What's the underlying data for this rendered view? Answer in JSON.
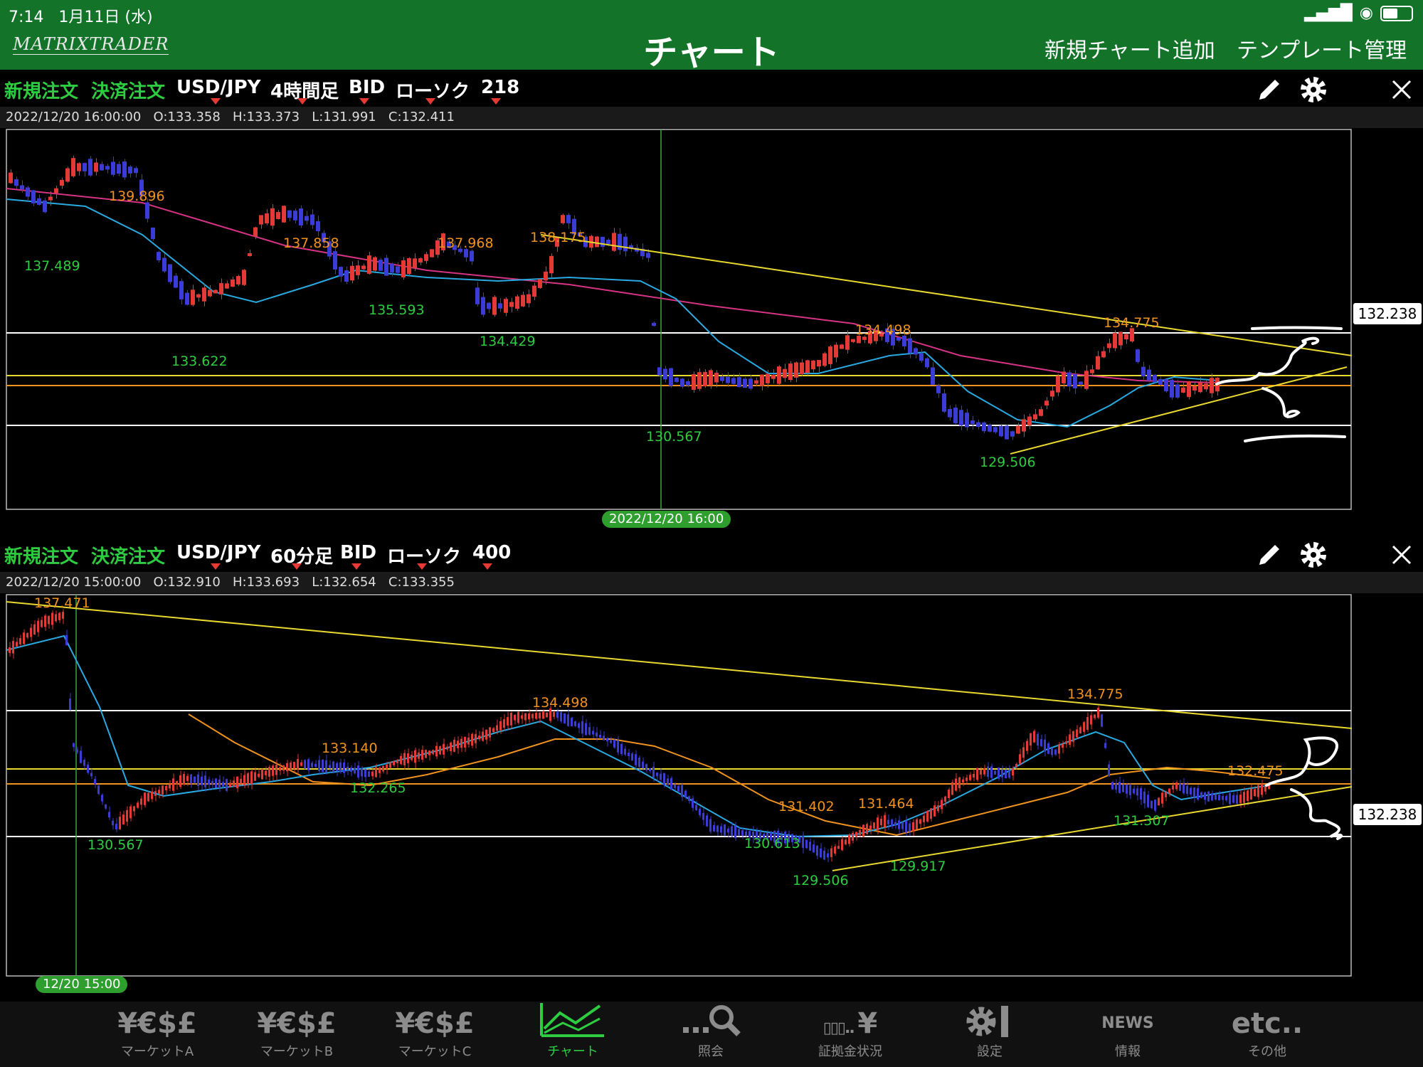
{
  "status": {
    "time": "7:14",
    "date": "1月11日 (水)"
  },
  "header": {
    "logo": "MATRIXTRADER",
    "title": "チャート",
    "add_chart": "新規チャート追加",
    "template": "テンプレート管理"
  },
  "panels": [
    {
      "new_order": "新規注文",
      "close_order": "決済注文",
      "pair": "USD/JPY",
      "timeframe": "4時間足",
      "price_type": "BID",
      "chart_style": "ローソク",
      "count": "218",
      "ohlc": "2022/12/20 16:00:00   O:133.358   H:133.373   L:131.991   C:132.411",
      "current_price": "132.238",
      "crosshair_date": "2022/12/20 16:00",
      "labels": [
        {
          "text": "139.896",
          "kind": "high"
        },
        {
          "text": "137.489",
          "kind": "low"
        },
        {
          "text": "137.858",
          "kind": "high"
        },
        {
          "text": "135.593",
          "kind": "low"
        },
        {
          "text": "133.622",
          "kind": "low"
        },
        {
          "text": "137.968",
          "kind": "high"
        },
        {
          "text": "134.429",
          "kind": "low"
        },
        {
          "text": "138.175",
          "kind": "high"
        },
        {
          "text": "130.567",
          "kind": "low"
        },
        {
          "text": "134.498",
          "kind": "high"
        },
        {
          "text": "129.506",
          "kind": "low"
        },
        {
          "text": "134.775",
          "kind": "high"
        }
      ]
    },
    {
      "new_order": "新規注文",
      "close_order": "決済注文",
      "pair": "USD/JPY",
      "timeframe": "60分足",
      "price_type": "BID",
      "chart_style": "ローソク",
      "count": "400",
      "ohlc": "2022/12/20 15:00:00   O:132.910   H:133.693   L:132.654   C:133.355",
      "current_price": "132.238",
      "crosshair_date": "12/20 15:00",
      "labels": [
        {
          "text": "137.471",
          "kind": "high"
        },
        {
          "text": "130.567",
          "kind": "low"
        },
        {
          "text": "133.140",
          "kind": "high"
        },
        {
          "text": "132.265",
          "kind": "low"
        },
        {
          "text": "134.498",
          "kind": "high"
        },
        {
          "text": "131.402",
          "kind": "high"
        },
        {
          "text": "130.613",
          "kind": "low"
        },
        {
          "text": "129.506",
          "kind": "low"
        },
        {
          "text": "131.464",
          "kind": "high"
        },
        {
          "text": "129.917",
          "kind": "low"
        },
        {
          "text": "134.775",
          "kind": "high"
        },
        {
          "text": "132.475",
          "kind": "high"
        },
        {
          "text": "131.307",
          "kind": "low"
        }
      ]
    }
  ],
  "nav": [
    {
      "icon": "¥€$£",
      "label": "マーケットA",
      "icon_name": "currency-icon"
    },
    {
      "icon": "¥€$£",
      "label": "マーケットB",
      "icon_name": "currency-icon"
    },
    {
      "icon": "¥€$£",
      "label": "マーケットC",
      "icon_name": "currency-icon"
    },
    {
      "icon": "",
      "label": "チャート",
      "icon_name": "chart-icon"
    },
    {
      "icon": "",
      "label": "照会",
      "icon_name": "search-icon"
    },
    {
      "icon": "¥",
      "label": "証拠金状況",
      "icon_name": "margin-icon"
    },
    {
      "icon": "",
      "label": "設定",
      "icon_name": "settings-icon"
    },
    {
      "icon": "NEWS",
      "label": "情報",
      "icon_name": "news-icon"
    },
    {
      "icon": "etc..",
      "label": "その他",
      "icon_name": "more-icon"
    }
  ],
  "colors": {
    "header": "#137329",
    "bull": "#e53935",
    "bear": "#3b3bd6",
    "ma_fast": "#29a9e0",
    "ma_slow": "#d63384",
    "ma_orange": "#f0921e",
    "trend": "#e8d830",
    "accent": "#2ecc40"
  }
}
